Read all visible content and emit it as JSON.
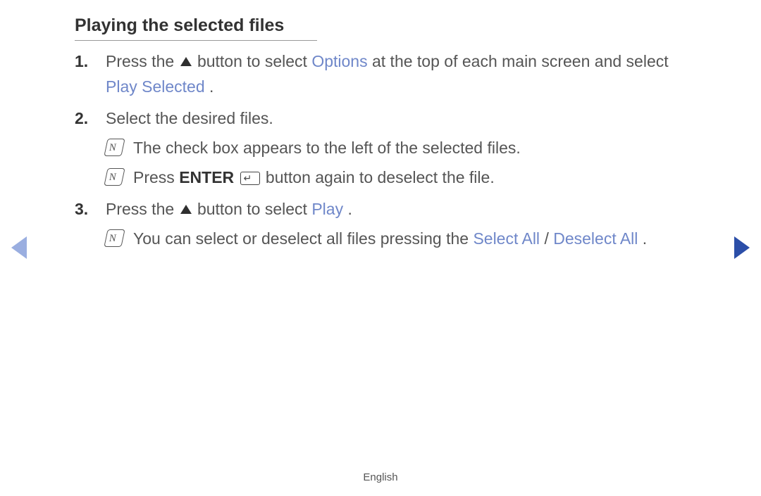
{
  "title": "Playing the selected files",
  "steps": {
    "s1": {
      "a": "Press the ",
      "b": " button to select ",
      "options": "Options",
      "c": " at the top of each main screen and select ",
      "playSelected": "Play Selected",
      "d": "."
    },
    "s2": {
      "text": "Select the desired files.",
      "note1": "The check box appears to the left of the selected files.",
      "note2a": "Press ",
      "enter": "ENTER",
      "note2b": " button again to deselect the file."
    },
    "s3": {
      "a": "Press the ",
      "b": " button to select ",
      "play": "Play",
      "c": ".",
      "noteA": "You can select or deselect all files pressing the ",
      "selectAll": "Select All",
      "slash": " / ",
      "deselectAll": "Deselect All",
      "noteB": "."
    }
  },
  "footer": "English"
}
